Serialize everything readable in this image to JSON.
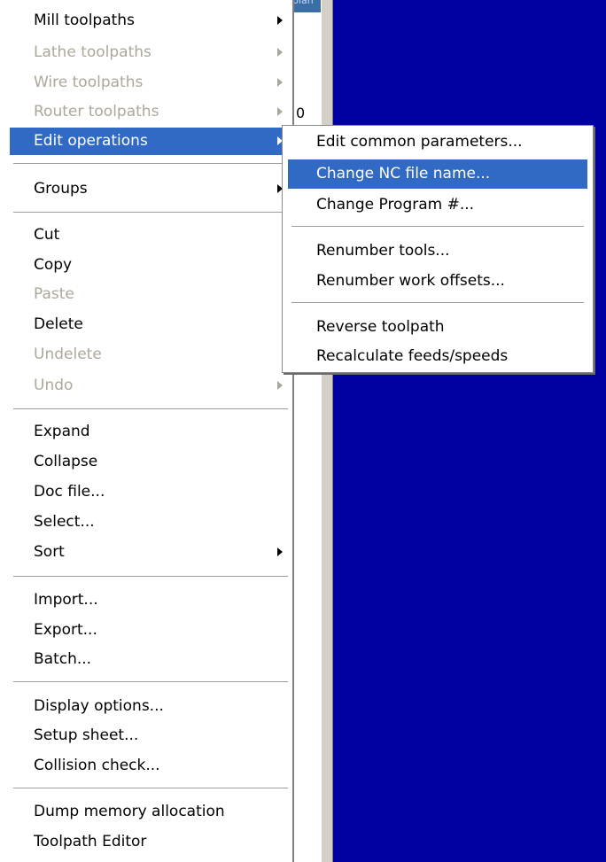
{
  "background": {
    "strip_text": "plan",
    "number_label": "0",
    "colors": {
      "workspace_blue": "#0000a0",
      "highlight": "#316ac5",
      "disabled_text": "#aca899"
    }
  },
  "menu": {
    "items": [
      {
        "label": "Mill toolpaths",
        "submenu": true,
        "disabled": false
      },
      {
        "label": "Lathe toolpaths",
        "submenu": true,
        "disabled": true
      },
      {
        "label": "Wire toolpaths",
        "submenu": true,
        "disabled": true
      },
      {
        "label": "Router toolpaths",
        "submenu": true,
        "disabled": true
      },
      {
        "label": "Edit operations",
        "submenu": true,
        "disabled": false,
        "highlighted": true
      },
      {
        "label": "Groups",
        "submenu": true,
        "disabled": false
      },
      {
        "label": "Cut",
        "submenu": false,
        "disabled": false
      },
      {
        "label": "Copy",
        "submenu": false,
        "disabled": false
      },
      {
        "label": "Paste",
        "submenu": false,
        "disabled": true
      },
      {
        "label": "Delete",
        "submenu": false,
        "disabled": false
      },
      {
        "label": "Undelete",
        "submenu": false,
        "disabled": true
      },
      {
        "label": "Undo",
        "submenu": true,
        "disabled": true
      },
      {
        "label": "Expand",
        "submenu": false,
        "disabled": false
      },
      {
        "label": "Collapse",
        "submenu": false,
        "disabled": false
      },
      {
        "label": "Doc file...",
        "submenu": false,
        "disabled": false
      },
      {
        "label": "Select...",
        "submenu": false,
        "disabled": false
      },
      {
        "label": "Sort",
        "submenu": true,
        "disabled": false
      },
      {
        "label": "Import...",
        "submenu": false,
        "disabled": false
      },
      {
        "label": "Export...",
        "submenu": false,
        "disabled": false
      },
      {
        "label": "Batch...",
        "submenu": false,
        "disabled": false
      },
      {
        "label": "Display options...",
        "submenu": false,
        "disabled": false
      },
      {
        "label": "Setup sheet...",
        "submenu": false,
        "disabled": false
      },
      {
        "label": "Collision check...",
        "submenu": false,
        "disabled": false
      },
      {
        "label": "Dump memory allocation",
        "submenu": false,
        "disabled": false
      },
      {
        "label": "Toolpath Editor",
        "submenu": false,
        "disabled": false
      }
    ]
  },
  "submenu": {
    "items": [
      {
        "label": "Edit common parameters..."
      },
      {
        "label": "Change NC file name...",
        "highlighted": true
      },
      {
        "label": "Change Program #..."
      },
      {
        "label": "Renumber tools..."
      },
      {
        "label": "Renumber work offsets..."
      },
      {
        "label": "Reverse toolpath"
      },
      {
        "label": "Recalculate feeds/speeds"
      }
    ]
  }
}
